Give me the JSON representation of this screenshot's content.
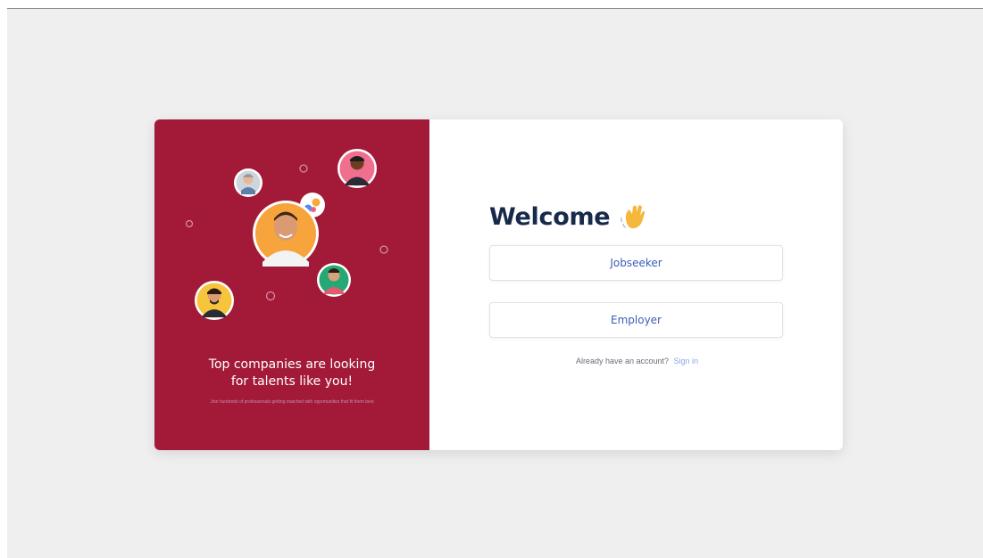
{
  "promo": {
    "headline": "Top companies are looking\nfor talents like you!",
    "subtext": "Join hundreds of professionals getting matched with opportunities that fit them best",
    "background_color": "#a31a39"
  },
  "auth": {
    "title": "Welcome",
    "title_icon": "waving-hand-icon",
    "buttons": {
      "jobseeker_label": "Jobseeker",
      "employer_label": "Employer"
    },
    "signin_prompt": "Already have an account?",
    "signin_link_label": "Sign in"
  },
  "colors": {
    "accent": "#3a5eb8",
    "title": "#18294a",
    "link": "#8aa6e6"
  }
}
